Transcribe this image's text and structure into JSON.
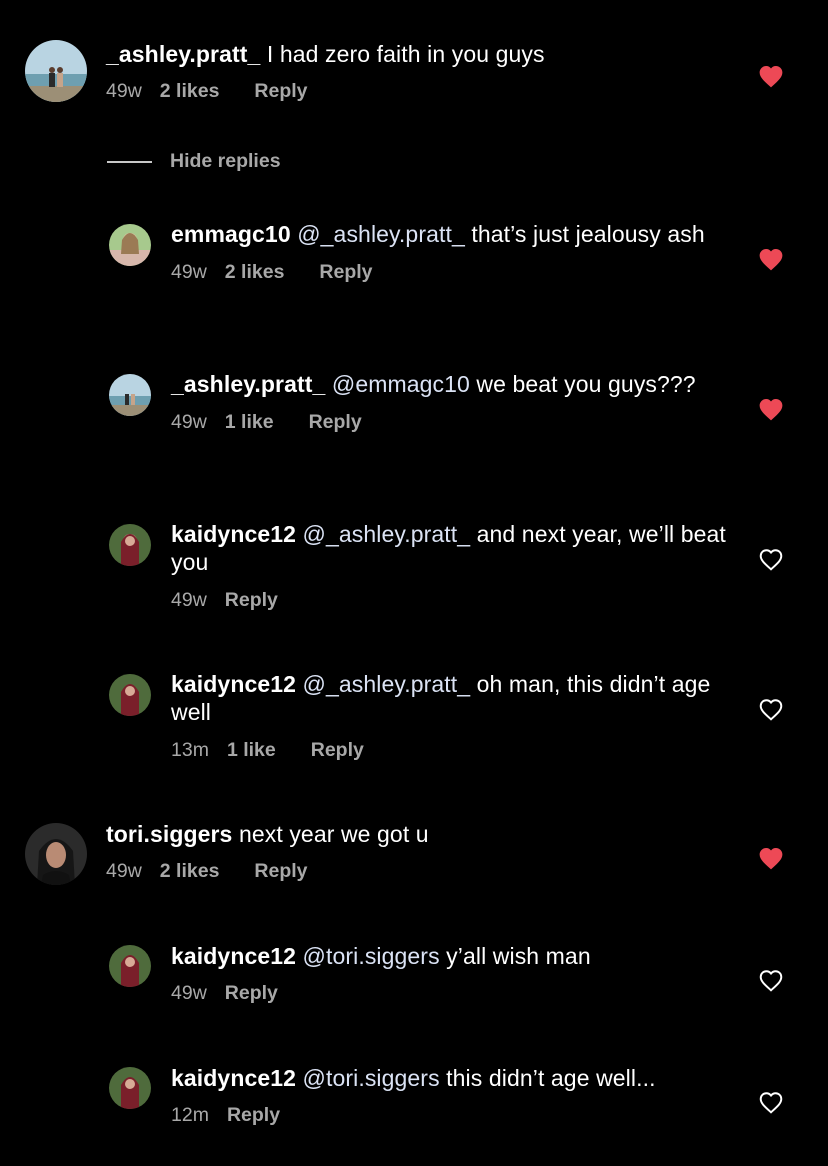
{
  "comments": [
    {
      "user": "_ashley.pratt_",
      "mention": "",
      "text": " I had zero faith in you guys",
      "time": "49w",
      "likes": "2 likes",
      "reply": "Reply",
      "liked": true
    },
    {
      "user": "emmagc10",
      "mention": "@_ashley.pratt_",
      "text": " that’s just jealousy ash",
      "time": "49w",
      "likes": "2 likes",
      "reply": "Reply",
      "liked": true
    },
    {
      "user": "_ashley.pratt_",
      "mention": "@emmagc10",
      "text": " we beat you guys???",
      "time": "49w",
      "likes": "1 like",
      "reply": "Reply",
      "liked": true
    },
    {
      "user": "kaidynce12",
      "mention": "@_ashley.pratt_",
      "text": " and next year, we’ll beat you",
      "time": "49w",
      "likes": "",
      "reply": "Reply",
      "liked": false
    },
    {
      "user": "kaidynce12",
      "mention": "@_ashley.pratt_",
      "text": " oh man, this didn’t age well",
      "time": "13m",
      "likes": "1 like",
      "reply": "Reply",
      "liked": false
    },
    {
      "user": "tori.siggers",
      "mention": "",
      "text": " next year we got u",
      "time": "49w",
      "likes": "2 likes",
      "reply": "Reply",
      "liked": true
    },
    {
      "user": "kaidynce12",
      "mention": "@tori.siggers",
      "text": " y’all wish man",
      "time": "49w",
      "likes": "",
      "reply": "Reply",
      "liked": false
    },
    {
      "user": "kaidynce12",
      "mention": "@tori.siggers",
      "text": " this didn’t age well...",
      "time": "12m",
      "likes": "",
      "reply": "Reply",
      "liked": false
    }
  ],
  "hide_replies": "Hide replies",
  "colors": {
    "heart_filled": "#ed4956",
    "heart_outline": "#ffffff",
    "meta_text": "#a8a8a8"
  },
  "icons": {
    "heart_filled": "heart-filled-icon",
    "heart_outline": "heart-outline-icon"
  }
}
